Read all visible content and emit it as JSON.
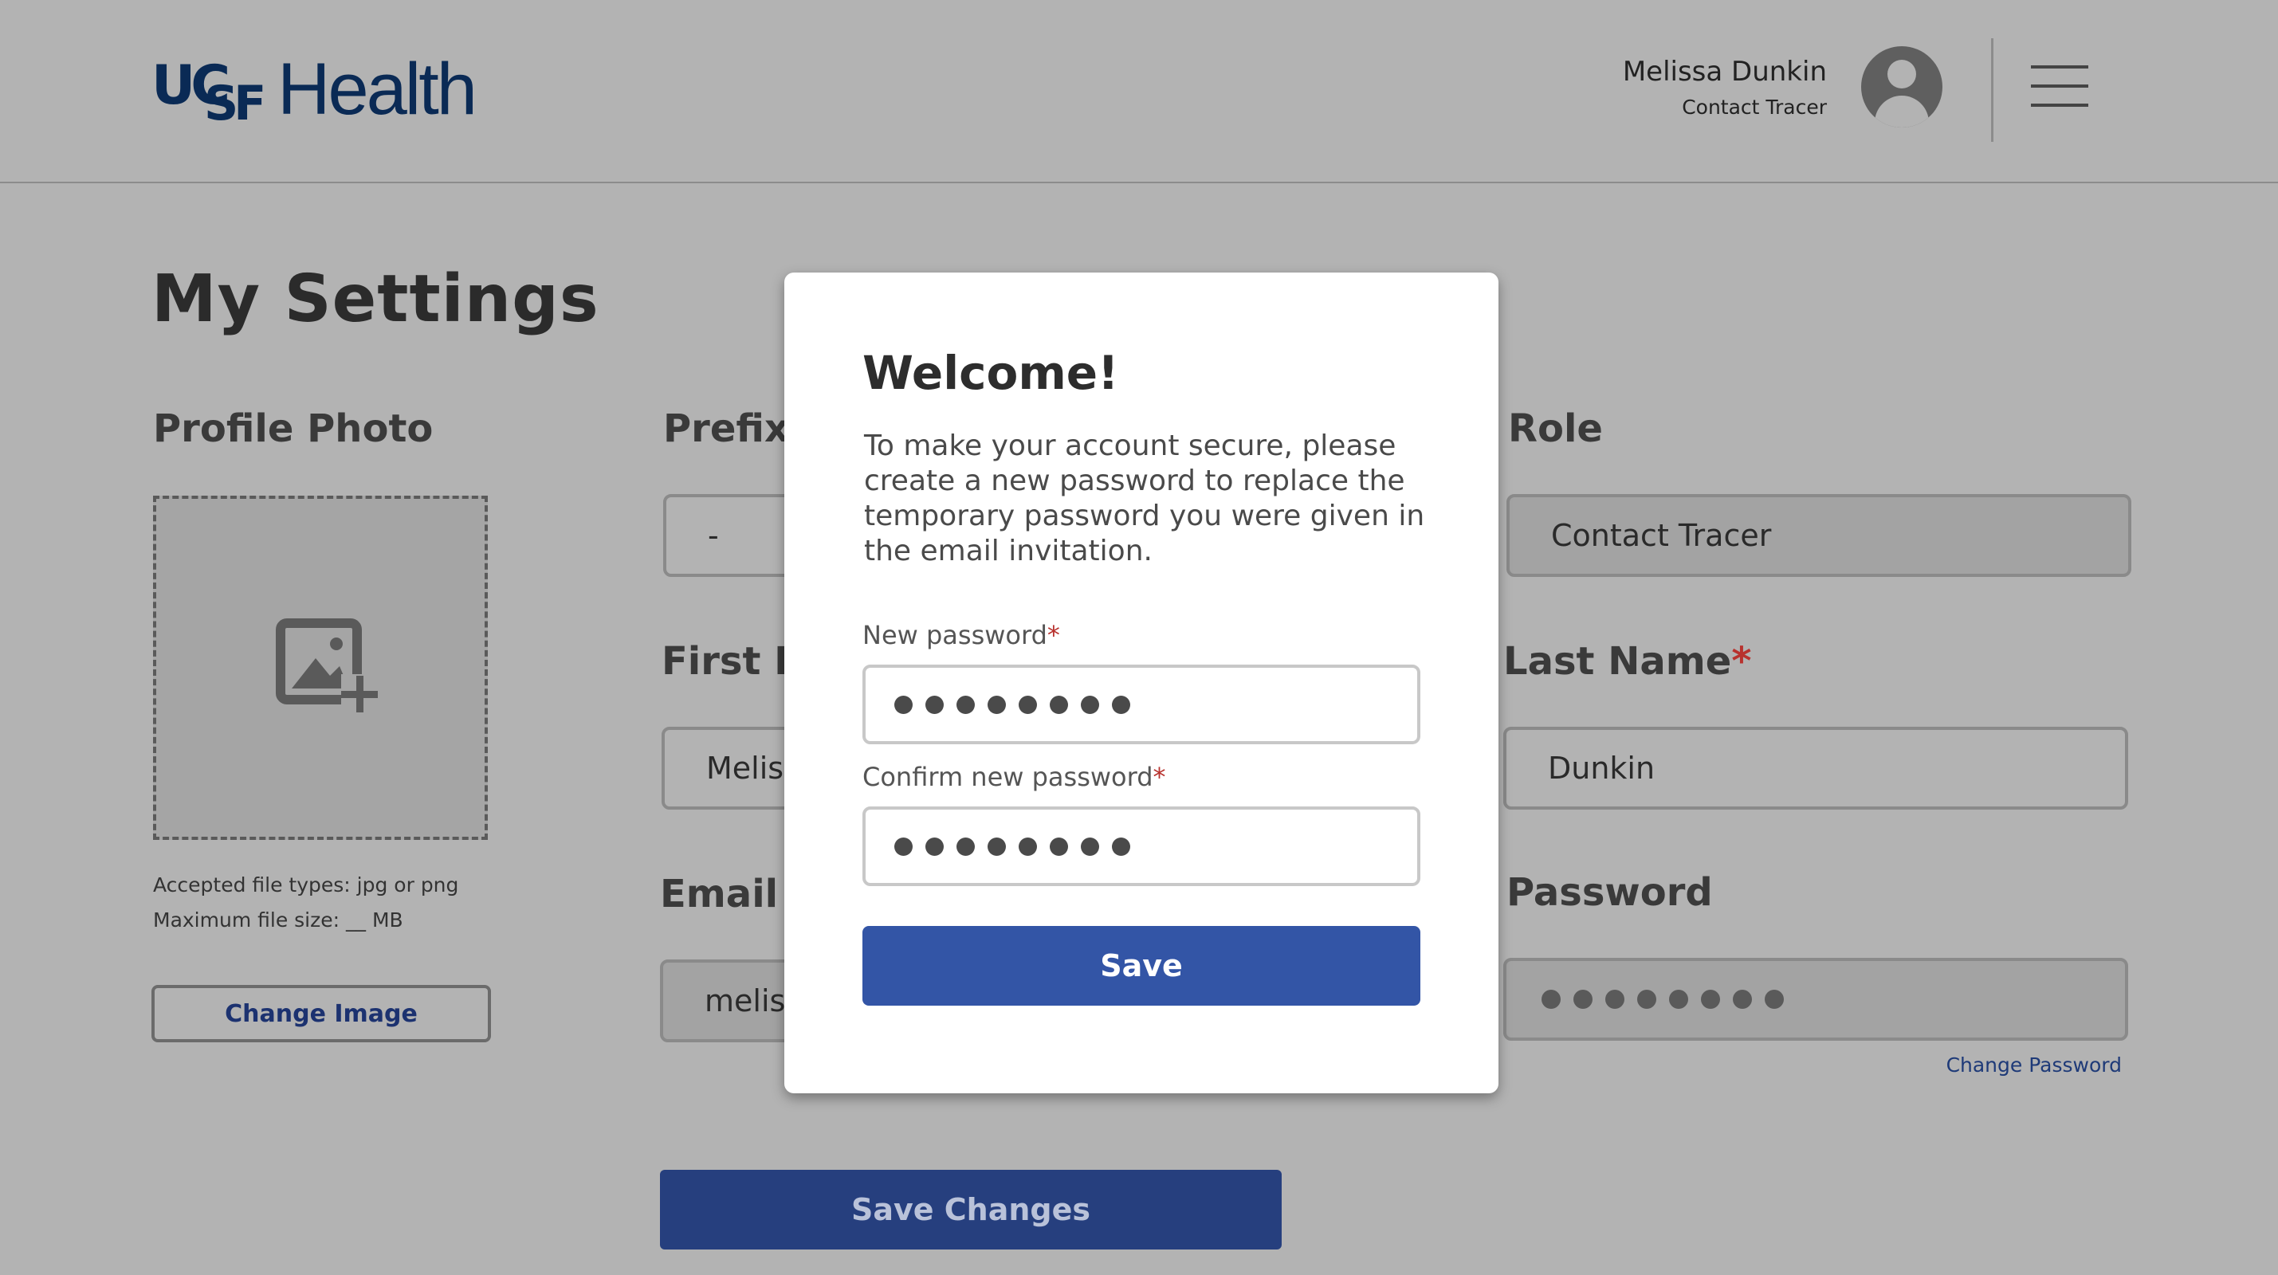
{
  "header": {
    "logo_uc": "UC",
    "logo_sf": "SF",
    "logo_health": "Health",
    "user_name": "Melissa Dunkin",
    "user_role": "Contact Tracer",
    "avatar_icon": "user-avatar-icon",
    "menu_icon": "hamburger-menu-icon"
  },
  "page": {
    "title": "My Settings"
  },
  "profile_photo": {
    "label": "Profile Photo",
    "placeholder_icon": "add-image-icon",
    "accepted_types": "Accepted file types: jpg or png",
    "max_size": "Maximum file size: __ MB",
    "change_button": "Change Image"
  },
  "form": {
    "prefix": {
      "label": "Prefix",
      "value": "-"
    },
    "first_name": {
      "label": "First N",
      "value": "Meliss"
    },
    "email": {
      "label": "Email",
      "value": "meliss"
    },
    "role": {
      "label": "Role",
      "value": "Contact Tracer"
    },
    "last_name": {
      "label": "Last Name",
      "required_mark": "*",
      "value": "Dunkin"
    },
    "password": {
      "label": "Password",
      "dot_count": 8,
      "change_link": "Change Password"
    },
    "save_changes_button": "Save Changes"
  },
  "modal": {
    "title": "Welcome!",
    "body": "To make your account secure, please create a new password to replace the temporary password you were given in the email invitation.",
    "new_password_label": "New password",
    "confirm_password_label": "Confirm new password",
    "required_mark": "*",
    "new_password_dot_count": 8,
    "confirm_password_dot_count": 8,
    "save_button": "Save"
  },
  "colors": {
    "overlay_background": "#b3b3b3",
    "brand_navy": "#0a2a55",
    "primary_button": "#3355a6",
    "required": "#b8322e"
  }
}
